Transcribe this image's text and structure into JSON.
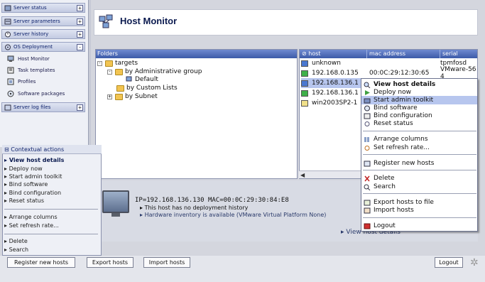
{
  "nav": {
    "headers": [
      {
        "label": "Server status",
        "icon": "server-status-icon",
        "toggle": "+"
      },
      {
        "label": "Server parameters",
        "icon": "server-parameters-icon",
        "toggle": "+"
      },
      {
        "label": "Server history",
        "icon": "server-history-icon",
        "toggle": "+"
      },
      {
        "label": "OS Deployment",
        "icon": "os-deployment-icon",
        "toggle": "-"
      },
      {
        "label": "Server log files",
        "icon": "server-log-files-icon",
        "toggle": "+"
      }
    ],
    "os_deployment_items": [
      {
        "label": "Host Monitor",
        "icon": "host-monitor-icon"
      },
      {
        "label": "Task templates",
        "icon": "task-templates-icon"
      },
      {
        "label": "Profiles",
        "icon": "profiles-icon"
      },
      {
        "label": "Software packages",
        "icon": "software-packages-icon"
      }
    ]
  },
  "header": {
    "title": "Host Monitor",
    "icon": "host-monitor-logo-icon"
  },
  "folders": {
    "heading": "Folders",
    "tree": [
      {
        "label": "targets",
        "toggle": "-"
      },
      {
        "label": "by Administrative group",
        "toggle": "-"
      },
      {
        "label": "Default"
      },
      {
        "label": "by Custom Lists"
      },
      {
        "label": "by Subnet",
        "toggle": "+"
      }
    ]
  },
  "hosts": {
    "columns": [
      "host",
      "mac address",
      "serial"
    ],
    "rows": [
      {
        "host": "unknown",
        "mac": "",
        "serial": "tpmfosd",
        "status_color": "#4a78d0"
      },
      {
        "host": "192.168.0.135",
        "mac": "00:0C:29:12:30:65",
        "serial": "VMware-56 4",
        "status_color": "#3fb04a"
      },
      {
        "host": "192.168.136.1",
        "mac": "",
        "serial": "",
        "status_color": "#4a78d0",
        "selected": true
      },
      {
        "host": "192.168.136.1",
        "mac": "",
        "serial": "",
        "status_color": "#3fb04a"
      },
      {
        "host": "win2003SP2-1",
        "mac": "",
        "serial": "",
        "status_color": "#f0e08a"
      }
    ]
  },
  "context_menu": {
    "items": [
      {
        "label": "View host details",
        "bold": true,
        "icon": "magnifier-icon"
      },
      {
        "label": "Deploy now",
        "icon": "play-icon"
      },
      {
        "label": "Start admin toolkit",
        "icon": "toolkit-icon",
        "highlighted": true
      },
      {
        "label": "Bind software",
        "icon": "software-icon"
      },
      {
        "label": "Bind configuration",
        "icon": "configuration-icon"
      },
      {
        "label": "Reset status",
        "icon": "reset-icon"
      },
      {
        "label": "Arrange columns",
        "icon": "columns-icon"
      },
      {
        "label": "Set refresh rate...",
        "icon": "refresh-icon"
      },
      {
        "label": "Register new hosts",
        "icon": "register-icon"
      },
      {
        "label": "Delete",
        "icon": "delete-icon"
      },
      {
        "label": "Search",
        "icon": "search-icon"
      },
      {
        "label": "Export hosts to file",
        "icon": "export-icon"
      },
      {
        "label": "Import hosts",
        "icon": "import-icon"
      },
      {
        "label": "Logout",
        "icon": "logout-icon"
      }
    ]
  },
  "detail": {
    "ip_line": "IP=192.168.136.130   MAC=00:0C:29:30:84:E8",
    "no_history": "This host has no deployment history",
    "hw_inventory": "Hardware inventory is available (VMware Virtual Platform None)",
    "view_details": "View host details"
  },
  "contextual_actions": {
    "title": "Contextual actions",
    "items": [
      "View host details",
      "Deploy now",
      "Start admin toolkit",
      "Bind software",
      "Bind configuration",
      "Reset status",
      "Arrange columns",
      "Set refresh rate...",
      "Delete",
      "Search"
    ]
  },
  "footer": {
    "register": "Register new hosts",
    "export": "Export hosts",
    "import": "Import hosts",
    "logout": "Logout"
  }
}
